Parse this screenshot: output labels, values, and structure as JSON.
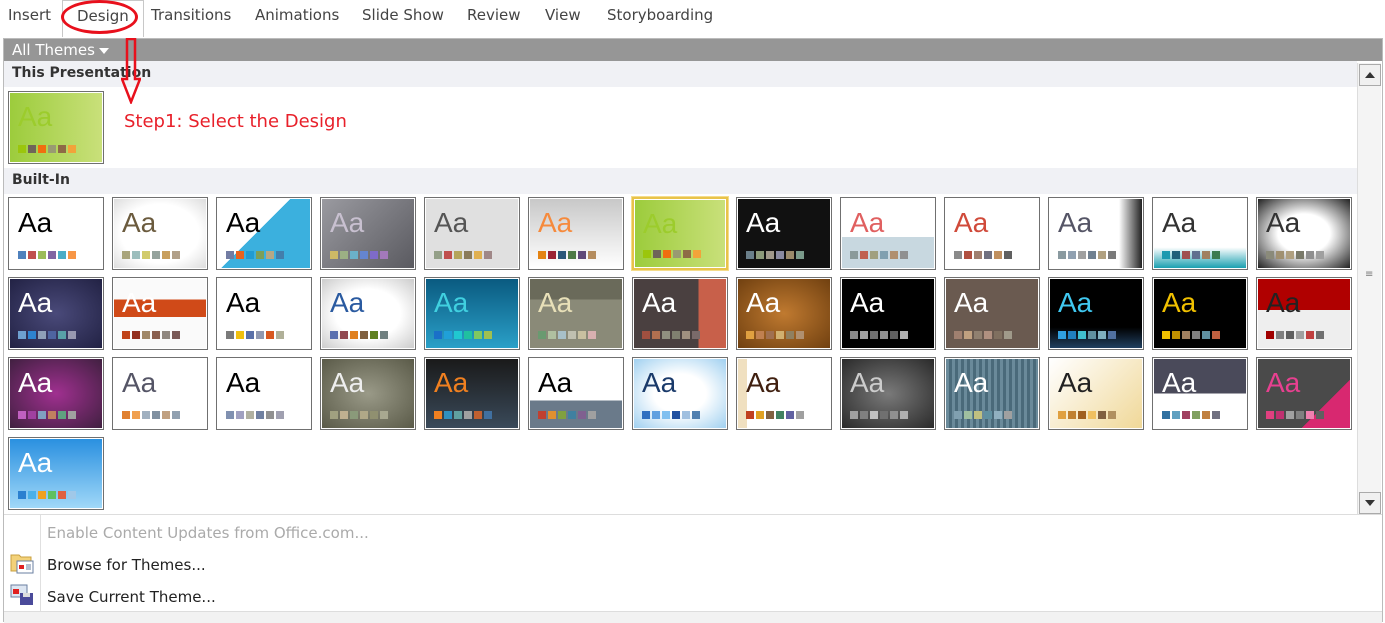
{
  "ribbon": {
    "tabs": [
      "Insert",
      "Design",
      "Transitions",
      "Animations",
      "Slide Show",
      "Review",
      "View",
      "Storyboarding"
    ],
    "active": "Design"
  },
  "gallery": {
    "filter_label": "All Themes",
    "section_this": "This Presentation",
    "section_builtin": "Built-In"
  },
  "annotation": {
    "step_text": "Step1: Select the Design",
    "color": "#e8202a"
  },
  "current_theme": {
    "bg": "linear-gradient(90deg,#9ccc3c,#c9e07a)",
    "fg": "#9ccc2c",
    "swatches": [
      "#9bc60c",
      "#6f6559",
      "#f06e0f",
      "#999a72",
      "#8e6a46",
      "#f2a33a"
    ]
  },
  "themes": [
    {
      "bg": "#ffffff",
      "fg": "#000",
      "sw": [
        "#4f81bd",
        "#c0504d",
        "#9bbb59",
        "#8064a2",
        "#4bacc6",
        "#f79646"
      ]
    },
    {
      "bg": "radial-gradient(#fff 60%,#ddd)",
      "fg": "#6b5b3e",
      "sw": [
        "#a9a57c",
        "#9cbebd",
        "#d2cb6c",
        "#95a39d",
        "#c89f5d",
        "#b1a089"
      ]
    },
    {
      "bg": "linear-gradient(135deg,#fff 45%,#3bb0de 45%)",
      "fg": "#000",
      "sw": [
        "#727ca3",
        "#e8621e",
        "#219bd1",
        "#7c9f59",
        "#b6a785",
        "#437eab"
      ]
    },
    {
      "bg": "linear-gradient(135deg,#9a9aa0,#5a5a60)",
      "fg": "#c8c0d0",
      "sw": [
        "#ceb966",
        "#9cb084",
        "#6bb1c9",
        "#6585cf",
        "#7e6bc9",
        "#a379bb"
      ]
    },
    {
      "bg": "#e0e0e0",
      "fg": "#555",
      "sw": [
        "#94a088",
        "#c0504d",
        "#b5a55a",
        "#8a7b5a",
        "#e0b050",
        "#a08888"
      ]
    },
    {
      "bg": "linear-gradient(#c8c8c8,#fff)",
      "fg": "#f68a3c",
      "sw": [
        "#e48312",
        "#9b2335",
        "#2a5779",
        "#4e7a47",
        "#5f497a",
        "#b48c5e"
      ]
    },
    {
      "bg": "linear-gradient(90deg,#9ccc3c,#c9e07a)",
      "fg": "#9ccc2c",
      "sw": [
        "#9bc60c",
        "#6f6559",
        "#f06e0f",
        "#999a72",
        "#8e6a46",
        "#f2a33a"
      ],
      "sel": true
    },
    {
      "bg": "#111",
      "fg": "#fff",
      "sw": [
        "#6a7f8a",
        "#8c9a7a",
        "#a0988a",
        "#8a8aa0",
        "#9a8a6a",
        "#7a9a8a"
      ]
    },
    {
      "bg": "linear-gradient(#fff 55%,#c8d8e0 55%)",
      "fg": "#e06060",
      "sw": [
        "#8a9a9a",
        "#c06050",
        "#a0a080",
        "#80a0b0",
        "#b09070",
        "#909090"
      ]
    },
    {
      "bg": "#fff",
      "fg": "#d04a3a",
      "sw": [
        "#8a8a8a",
        "#b05040",
        "#a08070",
        "#707080",
        "#c09060",
        "#606060"
      ]
    },
    {
      "bg": "linear-gradient(90deg,#fff 75%,#222)",
      "fg": "#556",
      "sw": [
        "#8a9aa0",
        "#90a0b0",
        "#a0a0a0",
        "#708090",
        "#b0a080",
        "#7a7a7a"
      ]
    },
    {
      "bg": "linear-gradient(#fff 70%,#1aa0b0)",
      "fg": "#333",
      "sw": [
        "#1c9ab0",
        "#20607a",
        "#a05050",
        "#607090",
        "#a08060",
        "#3a7a50"
      ]
    },
    {
      "bg": "radial-gradient(#fff 40%,#222)",
      "fg": "#333",
      "sw": [
        "#8a8a7a",
        "#a09070",
        "#b0a080",
        "#7a7a6a",
        "#909090",
        "#a0a0a0"
      ]
    },
    {
      "bg": "radial-gradient(#4a4a7a,#222244)",
      "fg": "#fff",
      "sw": [
        "#6ea0d0",
        "#2e83d0",
        "#8fa0b8",
        "#4e64a0",
        "#58a0a8",
        "#9898b0"
      ]
    },
    {
      "bg": "linear-gradient(#fafafa 30%,#d04a18 30%,#d04a18 55%,#fafafa 55%)",
      "fg": "#fff",
      "sw": [
        "#c0441a",
        "#943020",
        "#a08868",
        "#8a6050",
        "#908880",
        "#7a5a58"
      ]
    },
    {
      "bg": "#fff",
      "fg": "#000",
      "sw": [
        "#7a7a7a",
        "#f0c010",
        "#5a70a8",
        "#9098b0",
        "#d85820",
        "#b0b098"
      ]
    },
    {
      "bg": "radial-gradient(#fff 50%,#ccc)",
      "fg": "#2a5aa0",
      "sw": [
        "#5a70b0",
        "#904850",
        "#e08020",
        "#806040",
        "#608020",
        "#708080"
      ]
    },
    {
      "bg": "linear-gradient(#0a5a80,#2aa0c8)",
      "fg": "#40d0e0",
      "sw": [
        "#1a70c8",
        "#20a0d8",
        "#20c8d0",
        "#20c0a0",
        "#80c860",
        "#a0c050"
      ]
    },
    {
      "bg": "linear-gradient(#6a6a5a 30%,#8a8a78 30%)",
      "fg": "#e8e0b8",
      "sw": [
        "#6a9a70",
        "#b0c0a0",
        "#a8c0c8",
        "#c0c0b0",
        "#c8c0a0",
        "#d8b0b0"
      ]
    },
    {
      "bg": "linear-gradient(90deg,#4a4040 70%,#c8604a 70%)",
      "fg": "#fff",
      "sw": [
        "#a05040",
        "#b07050",
        "#909080",
        "#808070",
        "#a09080",
        "#7a6a6a"
      ]
    },
    {
      "bg": "radial-gradient(#c07a30,#704010)",
      "fg": "#fff",
      "sw": [
        "#e0a040",
        "#c08050",
        "#a07050",
        "#d0b070",
        "#908060",
        "#b09070"
      ]
    },
    {
      "bg": "#000",
      "fg": "#fff",
      "sw": [
        "#8a8a8a",
        "#a0a0a0",
        "#707070",
        "#909090",
        "#606060",
        "#b0b0b0"
      ]
    },
    {
      "bg": "#6a5a50",
      "fg": "#fff",
      "sw": [
        "#a08070",
        "#c0a080",
        "#908070",
        "#b09080",
        "#807060",
        "#a09a8a"
      ]
    },
    {
      "bg": "linear-gradient(#000 70%,#204060)",
      "fg": "#40c8f0",
      "sw": [
        "#30a0e0",
        "#2080c0",
        "#40c0d0",
        "#6090a0",
        "#80b0c0",
        "#5070a0"
      ]
    },
    {
      "bg": "#000",
      "fg": "#f0c000",
      "sw": [
        "#f0c000",
        "#c09000",
        "#a08060",
        "#808080",
        "#6090a0",
        "#c06040"
      ]
    },
    {
      "bg": "linear-gradient(#b00000 45%,#eee 45%)",
      "fg": "#222",
      "sw": [
        "#a00000",
        "#808080",
        "#606060",
        "#a0a0a0",
        "#c04040",
        "#707070"
      ]
    },
    {
      "bg": "radial-gradient(#a03090,#402040)",
      "fg": "#fff",
      "sw": [
        "#c060c0",
        "#a040a0",
        "#80a0c0",
        "#c08060",
        "#60a080",
        "#a0a0a0"
      ]
    },
    {
      "bg": "#fff",
      "fg": "#556",
      "sw": [
        "#e08030",
        "#f0a050",
        "#a0b0c0",
        "#8090a0",
        "#c0a080",
        "#90a0b0"
      ]
    },
    {
      "bg": "#fff",
      "fg": "#000",
      "sw": [
        "#8090b0",
        "#a0a0c0",
        "#b0b0a0",
        "#7080a0",
        "#909090",
        "#a0a0b0"
      ]
    },
    {
      "bg": "radial-gradient(#9a9a88,#5a5a48)",
      "fg": "#eee",
      "sw": [
        "#a0a080",
        "#c0b090",
        "#8a9a7a",
        "#b0a888",
        "#909070",
        "#a8a890"
      ]
    },
    {
      "bg": "linear-gradient(#1a1a1a,#3a4a5a)",
      "fg": "#f08020",
      "sw": [
        "#f08020",
        "#3090c0",
        "#60a0a0",
        "#a0a0a0",
        "#c06030",
        "#4070a0"
      ]
    },
    {
      "bg": "linear-gradient(#fff 60%,#6a7a8a 60%)",
      "fg": "#000",
      "sw": [
        "#c04030",
        "#e09030",
        "#80a040",
        "#4080a0",
        "#806090",
        "#a0a0a0"
      ]
    },
    {
      "bg": "radial-gradient(#fff 40%,#a0d0f0)",
      "fg": "#1a3a6a",
      "sw": [
        "#3070c0",
        "#60a0e0",
        "#80c0f0",
        "#2050a0",
        "#a0c0e0",
        "#5080b0"
      ]
    },
    {
      "bg": "linear-gradient(90deg,#f0e0c0 10%,#fff 10%)",
      "fg": "#402010",
      "sw": [
        "#c04020",
        "#e0a020",
        "#806040",
        "#408060",
        "#6060a0",
        "#a0a0a0"
      ]
    },
    {
      "bg": "radial-gradient(#7a7a7a,#2a2a2a)",
      "fg": "#ccc",
      "sw": [
        "#a0a0a0",
        "#808080",
        "#c0c0c0",
        "#707070",
        "#909090",
        "#b0b0b0"
      ]
    },
    {
      "bg": "repeating-linear-gradient(90deg,#6a8a9a 0 3px,#4a6a7a 3px 6px)",
      "fg": "#fff",
      "sw": [
        "#80a0b0",
        "#a0c0a0",
        "#c0c080",
        "#6090a0",
        "#90b0c0",
        "#a0a0a0"
      ]
    },
    {
      "bg": "linear-gradient(135deg,#fff,#f0d898)",
      "fg": "#222",
      "sw": [
        "#e0a040",
        "#c08030",
        "#a06020",
        "#f0c060",
        "#806040",
        "#b09060"
      ]
    },
    {
      "bg": "linear-gradient(#4a4a5a 50%,#fff 50%)",
      "fg": "#fff",
      "sw": [
        "#3070a0",
        "#60a0c0",
        "#a04060",
        "#80a060",
        "#c08040",
        "#707080"
      ]
    },
    {
      "bg": "linear-gradient(135deg,#4a4a4a 70%,#d82870 70%)",
      "fg": "#e84090",
      "sw": [
        "#e04080",
        "#c03070",
        "#a0a0a0",
        "#808080",
        "#f080b0",
        "#606060"
      ]
    },
    {
      "bg": "linear-gradient(#2a90e0,#a0d8f8)",
      "fg": "#fff",
      "sw": [
        "#2a80d0",
        "#4ab0e8",
        "#f0a020",
        "#60c060",
        "#e06040",
        "#a0c8e8"
      ]
    }
  ],
  "menu": {
    "items": [
      {
        "label": "Enable Content Updates from Office.com...",
        "disabled": true,
        "icon": "none"
      },
      {
        "label": "Browse for Themes...",
        "disabled": false,
        "icon": "folder-theme-icon"
      },
      {
        "label": "Save Current Theme...",
        "disabled": false,
        "icon": "save-theme-icon"
      }
    ]
  }
}
